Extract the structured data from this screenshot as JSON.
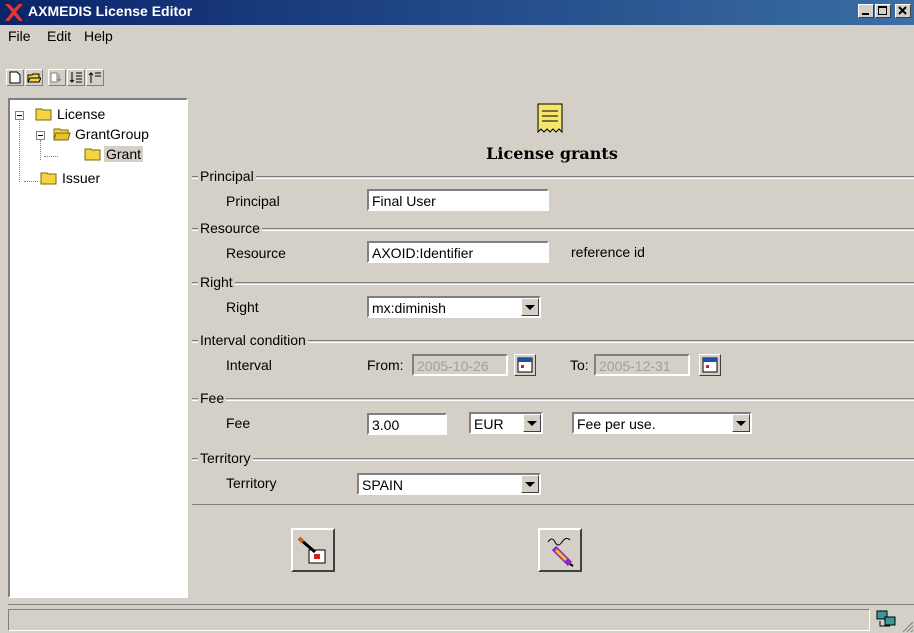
{
  "window": {
    "title": "AXMEDIS License Editor",
    "controls": [
      "minimize-icon",
      "maximize-icon",
      "close-icon"
    ]
  },
  "menu": {
    "items": [
      "File",
      "Edit",
      "Help"
    ]
  },
  "toolbar": {
    "icons": [
      "new-document-icon",
      "open-folder-icon",
      "add-child-icon",
      "sort-down-icon",
      "sort-up-icon"
    ]
  },
  "tree": {
    "root": "License",
    "group": "GrantGroup",
    "grant": "Grant",
    "issuer": "Issuer"
  },
  "main": {
    "heading": "License grants",
    "principal": {
      "group": "Principal",
      "label": "Principal",
      "value": "Final User"
    },
    "resource": {
      "group": "Resource",
      "label": "Resource",
      "value": "AXOID:Identifier",
      "hint": "reference id"
    },
    "right": {
      "group": "Right",
      "label": "Right",
      "value": "mx:diminish"
    },
    "interval": {
      "group": "Interval condition",
      "label": "Interval",
      "from_label": "From:",
      "from_value": "2005-10-26",
      "to_label": "To:",
      "to_value": "2005-12-31"
    },
    "fee": {
      "group": "Fee",
      "label": "Fee",
      "amount": "3.00",
      "currency": "EUR",
      "type": "Fee per use."
    },
    "territory": {
      "group": "Territory",
      "label": "Territory",
      "value": "SPAIN"
    }
  },
  "colors": {
    "title_bar_start": "#0a246a",
    "title_bar_end": "#3a6ea5",
    "window_face": "#d4d0c8",
    "folder": "#f5d442"
  }
}
